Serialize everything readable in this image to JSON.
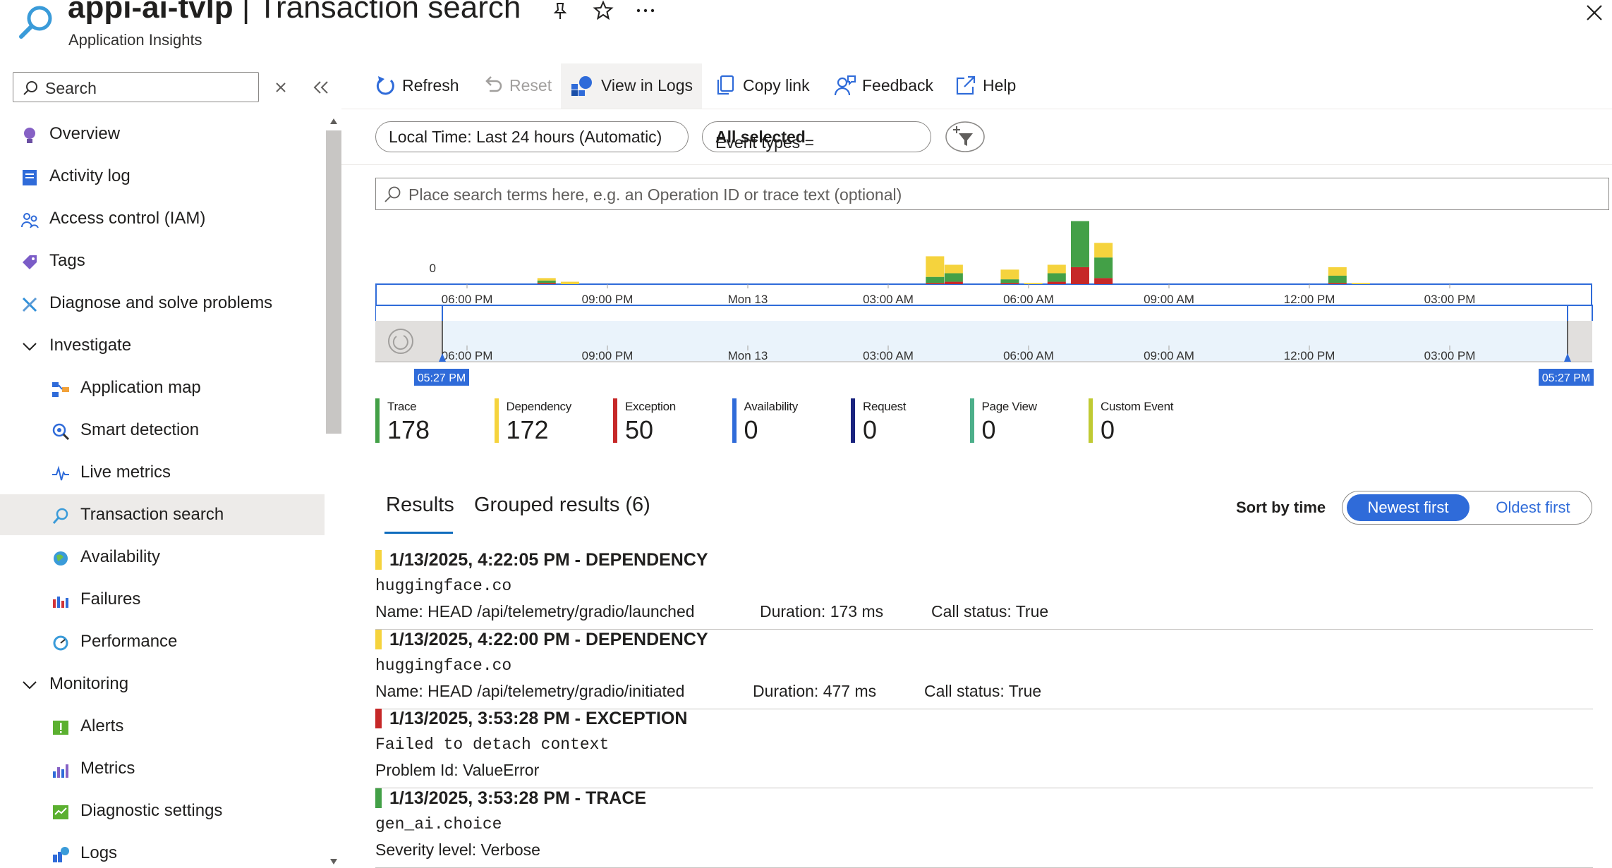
{
  "header": {
    "resource_name": "appi-ai-tvlp",
    "separator": " | ",
    "page_title": "Transaction search",
    "subtitle": "Application Insights"
  },
  "sidebar": {
    "search_placeholder": "Search",
    "items": [
      {
        "label": "Overview",
        "icon": "lightbulb-icon",
        "level": 0
      },
      {
        "label": "Activity log",
        "icon": "activity-log-icon",
        "level": 0
      },
      {
        "label": "Access control (IAM)",
        "icon": "people-icon",
        "level": 0
      },
      {
        "label": "Tags",
        "icon": "tag-icon",
        "level": 0
      },
      {
        "label": "Diagnose and solve problems",
        "icon": "wrench-icon",
        "level": 0
      },
      {
        "label": "Investigate",
        "icon": "chevron-down-icon",
        "level": 0
      },
      {
        "label": "Application map",
        "icon": "app-map-icon",
        "level": 1
      },
      {
        "label": "Smart detection",
        "icon": "smart-detection-icon",
        "level": 1
      },
      {
        "label": "Live metrics",
        "icon": "pulse-icon",
        "level": 1
      },
      {
        "label": "Transaction search",
        "icon": "search-icon",
        "level": 1,
        "selected": true
      },
      {
        "label": "Availability",
        "icon": "globe-icon",
        "level": 1
      },
      {
        "label": "Failures",
        "icon": "failures-icon",
        "level": 1
      },
      {
        "label": "Performance",
        "icon": "performance-icon",
        "level": 1
      },
      {
        "label": "Monitoring",
        "icon": "chevron-down-icon",
        "level": 0
      },
      {
        "label": "Alerts",
        "icon": "alert-icon",
        "level": 1
      },
      {
        "label": "Metrics",
        "icon": "metrics-icon",
        "level": 1
      },
      {
        "label": "Diagnostic settings",
        "icon": "diagnostic-settings-icon",
        "level": 1
      },
      {
        "label": "Logs",
        "icon": "logs-icon",
        "level": 1
      }
    ]
  },
  "toolbar": {
    "refresh": "Refresh",
    "reset": "Reset",
    "view_in_logs": "View in Logs",
    "copy_link": "Copy link",
    "feedback": "Feedback",
    "help": "Help"
  },
  "filters": {
    "time_range": "Local Time: Last 24 hours (Automatic)",
    "event_types_label": "Event types = ",
    "event_types_value": "All selected"
  },
  "search": {
    "placeholder": "Place search terms here, e.g. an Operation ID or trace text (optional)"
  },
  "chart_data": {
    "type": "bar",
    "stacked": true,
    "y_tick_label": "0",
    "x_ticks": [
      "06:00 PM",
      "09:00 PM",
      "Mon 13",
      "03:00 AM",
      "06:00 AM",
      "09:00 AM",
      "12:00 PM",
      "03:00 PM"
    ],
    "brush_start": "05:27 PM",
    "brush_end": "05:27 PM",
    "colors": {
      "Trace": "#43a047",
      "Dependency": "#f5d33d",
      "Exception": "#c62828"
    },
    "bars": [
      {
        "at_hours": 2.7,
        "Trace": 2,
        "Dependency": 2,
        "Exception": 1
      },
      {
        "at_hours": 3.2,
        "Trace": 0,
        "Dependency": 2,
        "Exception": 0
      },
      {
        "at_hours": 11.0,
        "Trace": 5,
        "Dependency": 17,
        "Exception": 1
      },
      {
        "at_hours": 11.4,
        "Trace": 7,
        "Dependency": 7,
        "Exception": 2
      },
      {
        "at_hours": 12.6,
        "Trace": 3,
        "Dependency": 8,
        "Exception": 1
      },
      {
        "at_hours": 13.1,
        "Trace": 0,
        "Dependency": 1,
        "Exception": 0
      },
      {
        "at_hours": 13.6,
        "Trace": 7,
        "Dependency": 7,
        "Exception": 2
      },
      {
        "at_hours": 14.1,
        "Trace": 38,
        "Dependency": 0,
        "Exception": 14
      },
      {
        "at_hours": 14.6,
        "Trace": 17,
        "Dependency": 12,
        "Exception": 5
      },
      {
        "at_hours": 19.6,
        "Trace": 6,
        "Dependency": 7,
        "Exception": 1
      },
      {
        "at_hours": 20.1,
        "Trace": 0,
        "Dependency": 1,
        "Exception": 0
      }
    ]
  },
  "legend": [
    {
      "name": "Trace",
      "count": "178",
      "color": "#43a047"
    },
    {
      "name": "Dependency",
      "count": "172",
      "color": "#f5d33d"
    },
    {
      "name": "Exception",
      "count": "50",
      "color": "#c62828"
    },
    {
      "name": "Availability",
      "count": "0",
      "color": "#2f6bd9"
    },
    {
      "name": "Request",
      "count": "0",
      "color": "#1a237e"
    },
    {
      "name": "Page View",
      "count": "0",
      "color": "#4caf8a"
    },
    {
      "name": "Custom Event",
      "count": "0",
      "color": "#c0ca33"
    }
  ],
  "results_tabs": {
    "results": "Results",
    "grouped": "Grouped results (6)"
  },
  "sort": {
    "label": "Sort by time",
    "newest": "Newest first",
    "oldest": "Oldest first"
  },
  "results": [
    {
      "color": "#f5d33d",
      "header": "1/13/2025, 4:22:05 PM  -  DEPENDENCY",
      "target": "huggingface.co",
      "d1": "Name: HEAD /api/telemetry/gradio/launched",
      "d2": "Duration: 173 ms",
      "d3": "Call status: True"
    },
    {
      "color": "#f5d33d",
      "header": "1/13/2025, 4:22:00 PM  -  DEPENDENCY",
      "target": "huggingface.co",
      "d1": "Name: HEAD /api/telemetry/gradio/initiated",
      "d2": "Duration: 477 ms",
      "d3": "Call status: True"
    },
    {
      "color": "#c62828",
      "header": "1/13/2025, 3:53:28 PM  -  EXCEPTION",
      "target": "Failed to detach context",
      "d1": "Problem Id: ValueError",
      "d2": "",
      "d3": ""
    },
    {
      "color": "#43a047",
      "header": "1/13/2025, 3:53:28 PM  -  TRACE",
      "target": "gen_ai.choice",
      "d1": "Severity level: Verbose",
      "d2": "",
      "d3": ""
    }
  ]
}
